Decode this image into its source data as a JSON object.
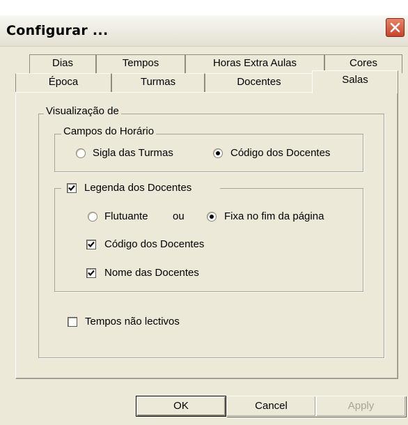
{
  "window": {
    "title": "Configurar ..."
  },
  "tabs": {
    "row1": [
      {
        "label": "Dias"
      },
      {
        "label": "Tempos"
      },
      {
        "label": "Horas Extra Aulas"
      },
      {
        "label": "Cores"
      }
    ],
    "row2": [
      {
        "label": "Época"
      },
      {
        "label": "Turmas"
      },
      {
        "label": "Docentes"
      },
      {
        "label": "Salas",
        "active": true
      }
    ]
  },
  "visualizacao": {
    "legend": "Visualização de",
    "campos": {
      "legend": "Campos do Horário",
      "sigla_label": "Sigla das Turmas",
      "sigla_selected": false,
      "codigo_label": "Código dos Docentes",
      "codigo_selected": true
    },
    "legenda": {
      "label": "Legenda dos Docentes",
      "checked": true,
      "flutuante_label": "Flutuante",
      "ou_label": "ou",
      "fixa_label": "Fixa no fim da página",
      "fixa_selected": true,
      "codigo_label": "Código dos Docentes",
      "codigo_checked": true,
      "nome_label": "Nome das Docentes",
      "nome_checked": true
    },
    "tempos_label": "Tempos não lectivos",
    "tempos_checked": false
  },
  "buttons": {
    "ok": "OK",
    "cancel": "Cancel",
    "apply": "Apply"
  }
}
